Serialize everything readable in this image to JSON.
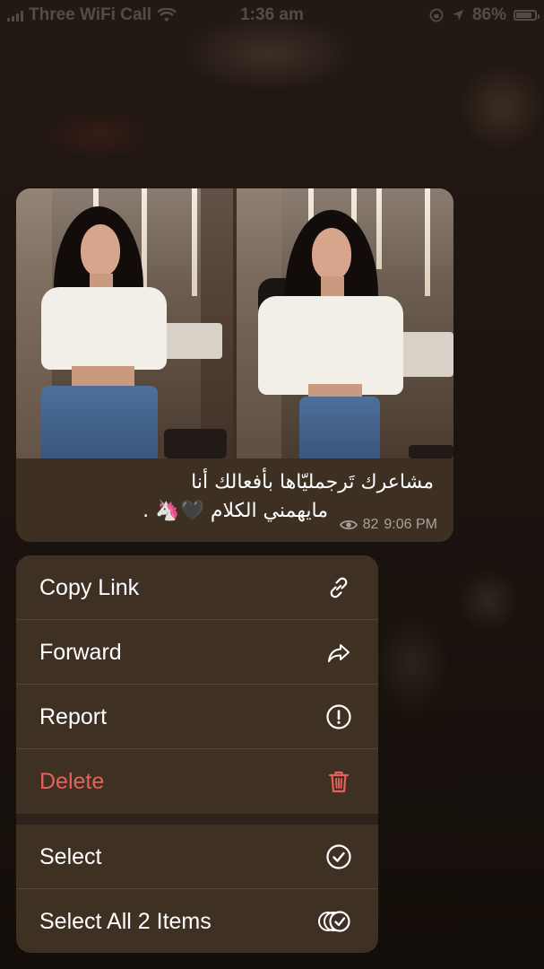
{
  "status_bar": {
    "carrier": "Three WiFi Call",
    "time": "1:36 am",
    "battery": "86%",
    "battery_level": 0.86
  },
  "message": {
    "caption_lines": [
      "مشاعرك تَرجمليّاها بأفعالك أنا",
      "مايهمني الكلام 🖤🦄 ."
    ],
    "views": "82",
    "time": "9:06 PM",
    "icons": {
      "views": "eye-icon"
    }
  },
  "menu": {
    "items": [
      {
        "label": "Copy Link",
        "icon": "link-icon"
      },
      {
        "label": "Forward",
        "icon": "forward-icon"
      },
      {
        "label": "Report",
        "icon": "report-icon"
      },
      {
        "label": "Delete",
        "icon": "trash-icon",
        "color": "#e5615c"
      },
      {
        "label": "Select",
        "icon": "check-circle-icon"
      },
      {
        "label": "Select All 2 Items",
        "icon": "multi-check-icon"
      }
    ]
  },
  "colors": {
    "bubble": "#3d3022",
    "menu": "#3f3024",
    "destructive": "#e5615c"
  }
}
